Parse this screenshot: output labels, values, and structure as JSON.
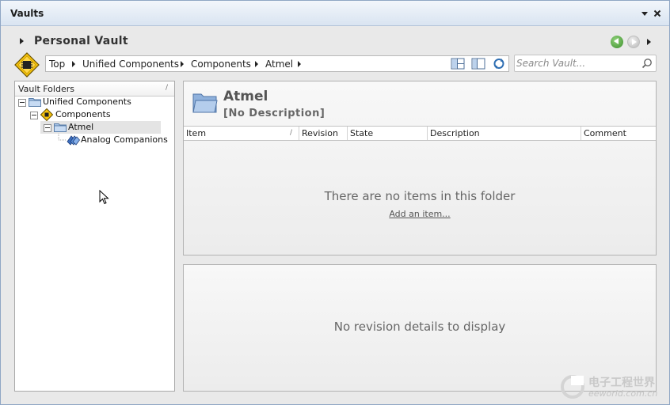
{
  "window": {
    "title": "Vaults"
  },
  "header": {
    "vault_name": "Personal Vault"
  },
  "breadcrumb": {
    "items": [
      "Top",
      "Unified Components",
      "Components",
      "Atmel"
    ]
  },
  "search": {
    "placeholder": "Search Vault..."
  },
  "folders_pane": {
    "header": "Vault Folders",
    "sort_indicator": "/",
    "tree": [
      {
        "label": "Unified Components",
        "icon": "folder-icon",
        "expanded": true
      },
      {
        "label": "Components",
        "icon": "component-icon",
        "expanded": true
      },
      {
        "label": "Atmel",
        "icon": "folder-icon",
        "expanded": true,
        "selected": true
      },
      {
        "label": "Analog Companions",
        "icon": "components-group-icon"
      }
    ]
  },
  "folder_panel": {
    "title": "Atmel",
    "description": "[No Description]",
    "columns": [
      "Item",
      "Revision",
      "State",
      "Description",
      "Comment"
    ],
    "item_sort_indicator": "/",
    "empty_message": "There are no items in this folder",
    "add_link": "Add an item..."
  },
  "revision_panel": {
    "empty_message": "No revision details to display"
  },
  "watermark": {
    "line1": "电子工程世界",
    "line2": "eeworld.com.cn"
  },
  "colors": {
    "title_bar": "#dbe5f2",
    "nav_back": "#4a9a36",
    "accent_yellow": "#f4c20d"
  }
}
